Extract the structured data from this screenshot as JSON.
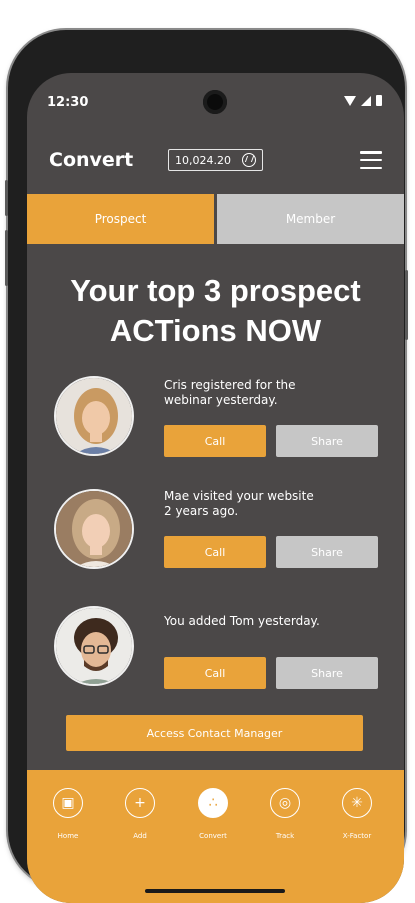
{
  "status": {
    "time": "12:30"
  },
  "header": {
    "title": "Convert",
    "balance": "10,024.20"
  },
  "tabs": [
    {
      "label": "Prospect",
      "active": true
    },
    {
      "label": "Member",
      "active": false
    }
  ],
  "heading": {
    "line1": "Your top 3 prospect",
    "line2": "ACTions NOW"
  },
  "actions": [
    {
      "name": "Cris",
      "line1": "Cris registered for the",
      "line2": "webinar yesterday.",
      "call_label": "Call",
      "share_label": "Share"
    },
    {
      "name": "Mae",
      "line1": "Mae visited your website",
      "line2": "2 years ago.",
      "call_label": "Call",
      "share_label": "Share"
    },
    {
      "name": "Tom",
      "line1": "You added Tom yesterday.",
      "line2": "",
      "call_label": "Call",
      "share_label": "Share"
    }
  ],
  "access_button": "Access Contact Manager",
  "bottom_nav": [
    {
      "label": "Home",
      "icon": "gift-icon",
      "active": false
    },
    {
      "label": "Add",
      "icon": "add-user-icon",
      "active": false
    },
    {
      "label": "Convert",
      "icon": "convert-icon",
      "active": true
    },
    {
      "label": "Track",
      "icon": "track-icon",
      "active": false
    },
    {
      "label": "X-Factor",
      "icon": "xfactor-icon",
      "active": false
    }
  ],
  "colors": {
    "accent": "#e9a33a",
    "background": "#4b4848",
    "inactive": "#c6c6c6"
  }
}
